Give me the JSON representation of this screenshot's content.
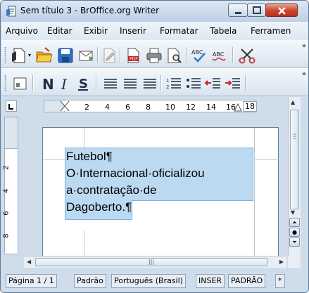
{
  "window": {
    "title": "Sem título 3 - BrOffice.org Writer"
  },
  "menu": [
    "Arquivo",
    "Editar",
    "Exibir",
    "Inserir",
    "Formatar",
    "Tabela",
    "Ferramen"
  ],
  "ruler": {
    "numbers": [
      "2",
      "4",
      "6",
      "8",
      "10",
      "12",
      "14",
      "16",
      "18"
    ]
  },
  "vruler": {
    "numbers": [
      "2",
      "4",
      "6",
      "8"
    ]
  },
  "document": {
    "lines": [
      "Futebol¶",
      "O·Internacional·oficializou",
      "a·contratação·de",
      "Dagoberto."
    ],
    "end_mark": "¶"
  },
  "statusbar": {
    "page": "Página 1 / 1",
    "style": "Padrão",
    "language": "Português (Brasil)",
    "insert_mode": "INSER",
    "selection_mode": "PADRÃO",
    "modified": "*"
  },
  "colors": {
    "selection": "#bcd9f2",
    "close_button": "#c9432c",
    "chrome": "#cfdcea"
  }
}
